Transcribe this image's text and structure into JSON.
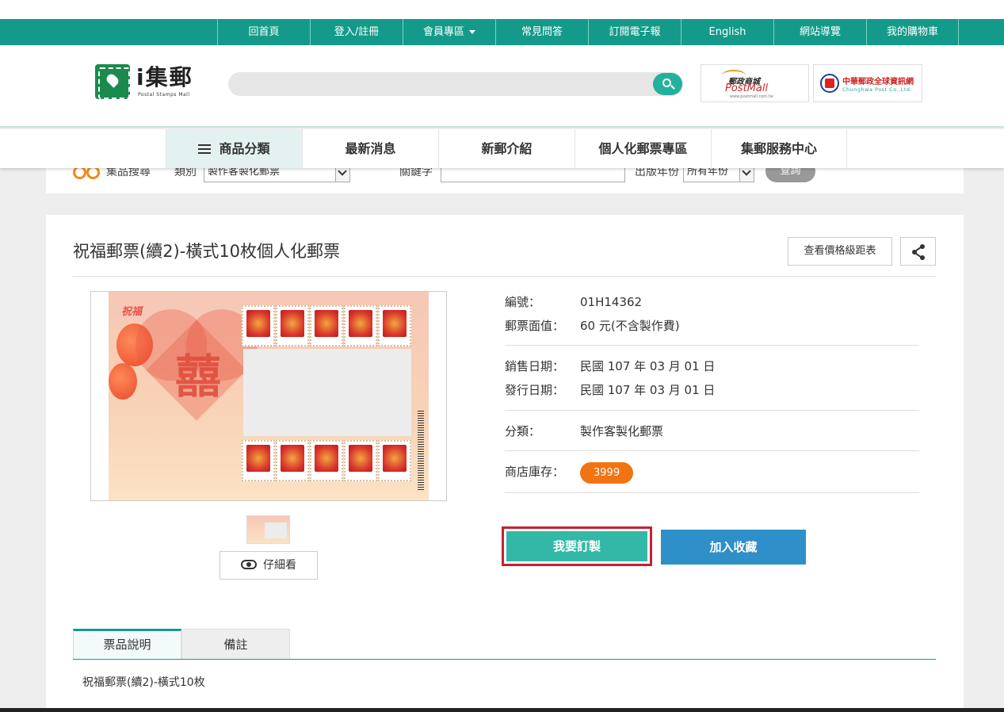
{
  "topnav": {
    "items": [
      {
        "label": "回首頁",
        "width": 117
      },
      {
        "label": "登入/註冊",
        "width": 117
      },
      {
        "label": "會員專區",
        "width": 117
      },
      {
        "label": "常見問答",
        "width": 117
      },
      {
        "label": "訂閱電子報",
        "width": 117
      },
      {
        "label": "English",
        "width": 117
      },
      {
        "label": "網站導覽",
        "width": 117
      },
      {
        "label": "我的購物車",
        "width": 117
      }
    ]
  },
  "header": {
    "logo_text": "i集郵",
    "logo_sub": "Postal Stamps Mall",
    "search_placeholder": "",
    "partner1_title": "郵政商城",
    "partner1_name": "PostMall",
    "partner1_url": "www.postmall.com.tw",
    "partner2_name": "中華郵政全球資訊網",
    "partner2_en": "Chunghwa Post Co.,Ltd."
  },
  "catnav": {
    "items": [
      "商品分類",
      "最新消息",
      "新郵介紹",
      "個人化郵票專區",
      "集郵服務中心"
    ]
  },
  "quick_search": {
    "label": "集品搜尋",
    "type_label": "類別",
    "type_value": "製作客製化郵票",
    "keyword_label": "關鍵字",
    "year_label": "出版年份",
    "year_value": "所有年份",
    "submit": "查詢"
  },
  "product": {
    "title": "祝福郵票(續2)-橫式10枚個人化郵票",
    "price_table_btn": "查看價格級距表",
    "sheet_logo": "祝福",
    "sheet_xi": "囍",
    "fields": {
      "id_key": "編號：",
      "id_val": "01H14362",
      "face_key": "郵票面值：",
      "face_val": "60 元(不含製作費)",
      "sale_key": "銷售日期：",
      "sale_val": "民國 107 年 03 月 01 日",
      "issue_key": "發行日期：",
      "issue_val": "民國 107 年 03 月 01 日",
      "cat_key": "分類：",
      "cat_val": "製作客製化郵票",
      "stock_key": "商店庫存：",
      "stock_val": "3999"
    },
    "detail_btn": "仔細看",
    "order_btn": "我要訂製",
    "fav_btn": "加入收藏"
  },
  "tabs": {
    "items": [
      "票品說明",
      "備註"
    ],
    "content": "祝福郵票(續2)-橫式10枚"
  }
}
